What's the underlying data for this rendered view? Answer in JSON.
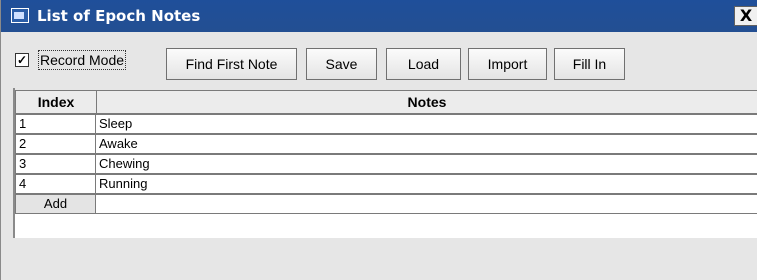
{
  "window": {
    "title": "List of Epoch Notes",
    "close_label": "X"
  },
  "toolbar": {
    "record_mode_label": "Record Mode",
    "record_mode_checked": true,
    "checkmark": "✓",
    "buttons": [
      "Find First Note",
      "Save",
      "Load",
      "Import",
      "Fill In"
    ]
  },
  "table": {
    "headers": {
      "index": "Index",
      "notes": "Notes"
    },
    "rows": [
      {
        "index": "1",
        "note": "Sleep"
      },
      {
        "index": "2",
        "note": "Awake"
      },
      {
        "index": "3",
        "note": "Chewing"
      },
      {
        "index": "4",
        "note": "Running"
      }
    ],
    "add_label": "Add"
  }
}
